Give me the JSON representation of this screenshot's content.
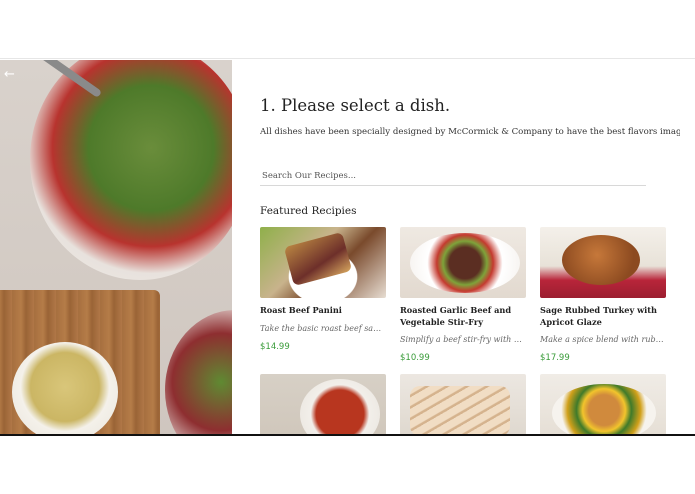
{
  "header": {
    "back_icon": "arrow-left-icon"
  },
  "main": {
    "title": "1. Please select a dish.",
    "subtitle": "All dishes have been specially designed by McCormick & Company to have the best flavors imaginable.",
    "search_placeholder": "Search Our Recipes...",
    "section_title": "Featured Recipies"
  },
  "recipes": [
    {
      "name": "Roast Beef Panini",
      "desc": "Take the basic roast beef sandwich to the next level",
      "price": "$14.99"
    },
    {
      "name": "Roasted Garlic Beef and Vegetable Stir-Fry",
      "desc": "Simplify a beef stir-fry with Roasted Garlic",
      "price": "$10.99"
    },
    {
      "name": "Sage Rubbed Turkey with Apricot Glaze",
      "desc": "Make a spice blend with rubbed sage",
      "price": "$17.99"
    }
  ]
}
